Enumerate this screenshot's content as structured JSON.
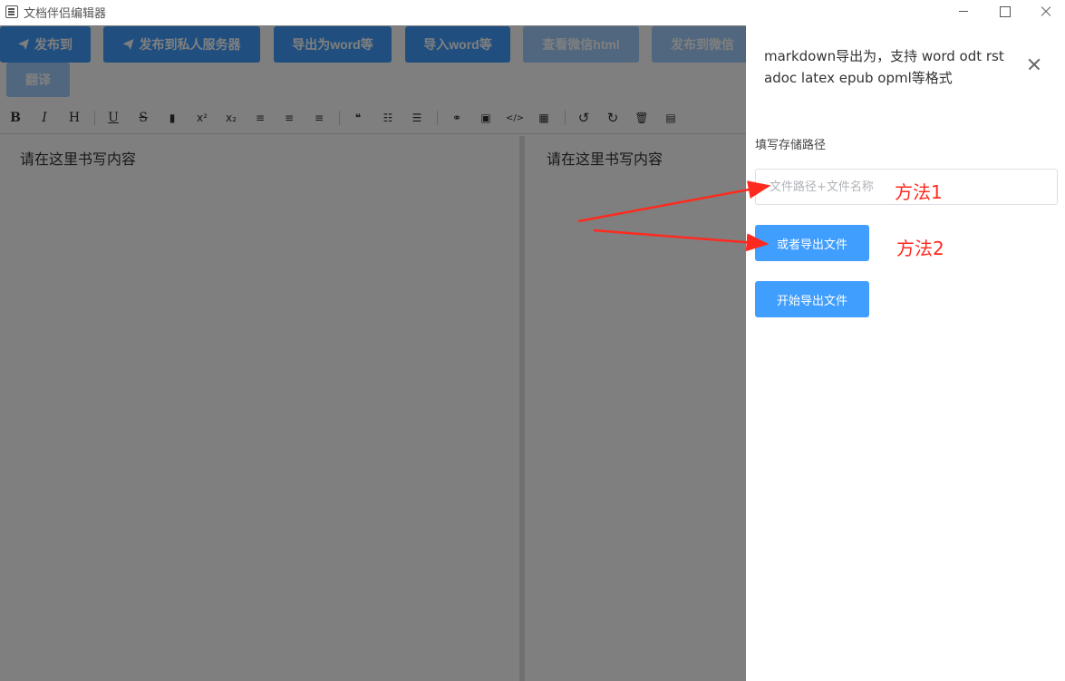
{
  "window": {
    "title": "文档伴侣编辑器",
    "icons": {
      "app": "document-app-icon",
      "minimize": "minimize-icon",
      "maximize": "maximize-icon",
      "close": "close-icon"
    }
  },
  "toolbar_buttons": [
    {
      "label": "发布到",
      "icon": "send-icon",
      "disabled": false
    },
    {
      "label": "发布到私人服务器",
      "icon": "send-icon",
      "disabled": false
    },
    {
      "label": "导出为word等",
      "disabled": false
    },
    {
      "label": "导入word等",
      "disabled": false
    },
    {
      "label": "查看微信html",
      "disabled": true
    },
    {
      "label": "发布到微信",
      "disabled": true
    },
    {
      "label": "翻译",
      "disabled": true
    }
  ],
  "format_toolbar": {
    "items": [
      {
        "glyph": "B",
        "icon": "bold-icon"
      },
      {
        "glyph": "I",
        "icon": "italic-icon"
      },
      {
        "glyph": "H",
        "icon": "heading-icon"
      },
      {
        "glyph": "U",
        "icon": "underline-icon"
      },
      {
        "glyph": "S",
        "icon": "strikethrough-icon"
      },
      {
        "glyph": "▮",
        "icon": "bookmark-icon"
      },
      {
        "glyph": "x²",
        "icon": "superscript-icon"
      },
      {
        "glyph": "x₂",
        "icon": "subscript-icon"
      },
      {
        "glyph": "≡",
        "icon": "align-left-icon"
      },
      {
        "glyph": "≡",
        "icon": "align-center-icon"
      },
      {
        "glyph": "≡",
        "icon": "align-right-icon"
      },
      {
        "glyph": "❝",
        "icon": "quote-icon"
      },
      {
        "glyph": "☷",
        "icon": "ordered-list-icon"
      },
      {
        "glyph": "☰",
        "icon": "unordered-list-icon"
      },
      {
        "glyph": "⚭",
        "icon": "link-icon"
      },
      {
        "glyph": "▣",
        "icon": "image-icon"
      },
      {
        "glyph": "</>",
        "icon": "code-icon"
      },
      {
        "glyph": "▦",
        "icon": "table-icon"
      },
      {
        "glyph": "↺",
        "icon": "undo-icon"
      },
      {
        "glyph": "↻",
        "icon": "redo-icon"
      },
      {
        "glyph": "🗑",
        "icon": "trash-icon"
      },
      {
        "glyph": "▤",
        "icon": "save-icon"
      }
    ]
  },
  "editor": {
    "left_placeholder": "请在这里书写内容",
    "right_placeholder": "请在这里书写内容"
  },
  "drawer": {
    "title": "markdown导出为，支持 word odt rst adoc latex epub opml等格式",
    "field_label": "填写存储路径",
    "path_placeholder": "文件路径+文件名称",
    "export_file_button": "或者导出文件",
    "start_export_button": "开始导出文件"
  },
  "annotations": {
    "method1": "方法1",
    "method2": "方法2",
    "color": "#ff2a1f"
  },
  "colors": {
    "primary": "#409eff",
    "primary_disabled": "#a0cfff",
    "overlay": "rgba(0,0,0,0.5)"
  }
}
